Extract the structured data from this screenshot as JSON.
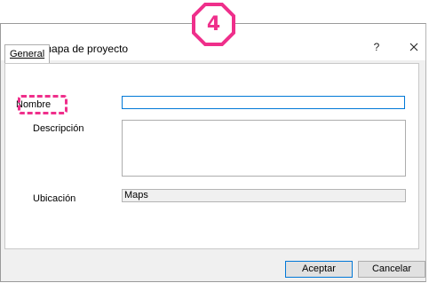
{
  "dialog": {
    "title": "Nuevo mapa de proyecto",
    "help_label": "?",
    "close_icon": "close-icon"
  },
  "tabs": [
    {
      "label": "General"
    }
  ],
  "form": {
    "name_label": "Nombre",
    "name_value": "",
    "description_label": "Descripción",
    "description_value": "",
    "location_label": "Ubicación",
    "location_value": "Maps"
  },
  "buttons": {
    "ok_label": "Aceptar",
    "cancel_label": "Cancelar"
  },
  "annotation": {
    "step_number": "4",
    "highlight_color": "#ef2f8b"
  }
}
